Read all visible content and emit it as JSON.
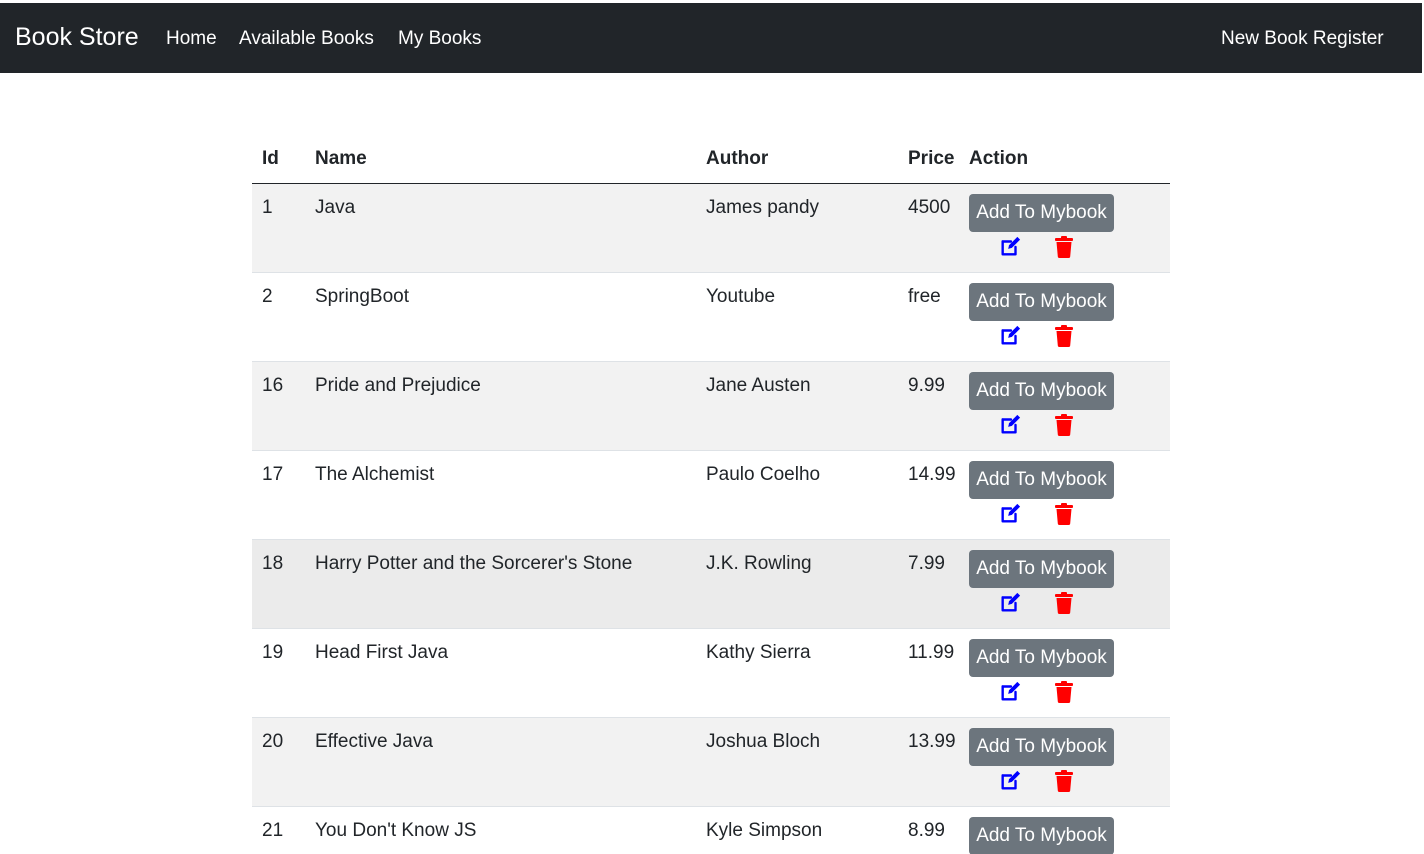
{
  "navbar": {
    "brand": "Book Store",
    "links": [
      "Home",
      "Available Books",
      "My Books"
    ],
    "right_link": "New Book Register"
  },
  "table": {
    "headers": [
      "Id",
      "Name",
      "Author",
      "Price",
      "Action"
    ],
    "add_button_label": "Add To Mybook",
    "rows": [
      {
        "id": "1",
        "name": "Java",
        "author": "James pandy",
        "price": "4500"
      },
      {
        "id": "2",
        "name": "SpringBoot",
        "author": "Youtube",
        "price": "free"
      },
      {
        "id": "16",
        "name": "Pride and Prejudice",
        "author": "Jane Austen",
        "price": "9.99"
      },
      {
        "id": "17",
        "name": "The Alchemist",
        "author": "Paulo Coelho",
        "price": "14.99"
      },
      {
        "id": "18",
        "name": "Harry Potter and the Sorcerer's Stone",
        "author": "J.K. Rowling",
        "price": "7.99"
      },
      {
        "id": "19",
        "name": "Head First Java",
        "author": "Kathy Sierra",
        "price": "11.99"
      },
      {
        "id": "20",
        "name": "Effective Java",
        "author": "Joshua Bloch",
        "price": "13.99"
      },
      {
        "id": "21",
        "name": "You Don't Know JS",
        "author": "Kyle Simpson",
        "price": "8.99"
      }
    ],
    "edit_icon": "edit-icon",
    "delete_icon": "trash-icon"
  },
  "colors": {
    "navbar_bg": "#212529",
    "button_bg": "#6c757d",
    "edit_icon": "#0000ff",
    "delete_icon": "#ff0000",
    "striped_row": "#f2f2f2"
  }
}
